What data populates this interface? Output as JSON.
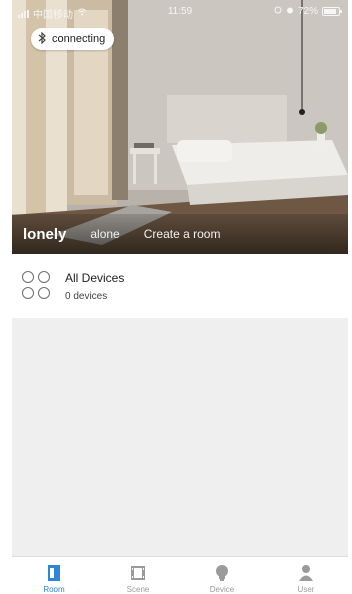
{
  "status_bar": {
    "carrier": "中国移动",
    "time": "11:59",
    "battery": "72%"
  },
  "connection": {
    "label": "connecting"
  },
  "room_tabs": {
    "active": "lonely",
    "items": [
      "alone",
      "Create a room"
    ]
  },
  "summary": {
    "title": "All Devices",
    "count": "0 devices"
  },
  "tabbar": {
    "items": [
      {
        "label": "Room",
        "icon": "room-icon",
        "active": true
      },
      {
        "label": "Scene",
        "icon": "scene-icon",
        "active": false
      },
      {
        "label": "Device",
        "icon": "bulb-icon",
        "active": false
      },
      {
        "label": "User",
        "icon": "user-icon",
        "active": false
      }
    ]
  },
  "colors": {
    "accent": "#2f86d6",
    "inactive": "#9a9a9a",
    "content_bg": "#efefef"
  }
}
